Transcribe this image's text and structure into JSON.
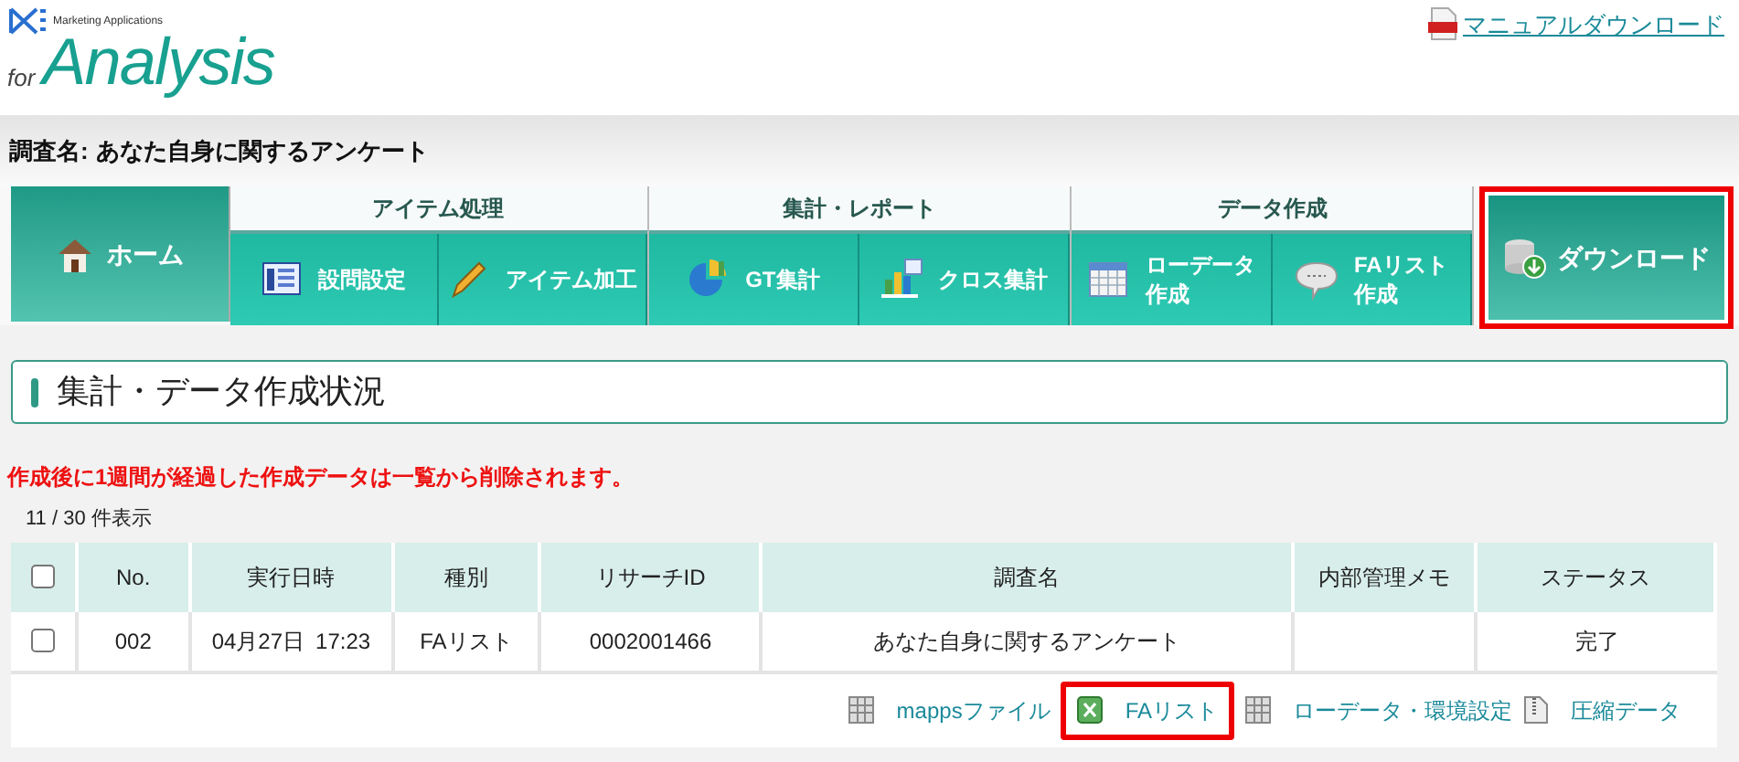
{
  "header": {
    "logo_tagline": "Marketing Applications",
    "logo_for": "for",
    "logo_name": "Analysis",
    "manual_link": "マニュアルダウンロード"
  },
  "survey_bar": {
    "label": "調査名:",
    "value": "あなた自身に関するアンケート"
  },
  "nav": {
    "home": {
      "label": "ホーム",
      "selected": true
    },
    "groups": [
      {
        "title": "アイテム処理",
        "items": [
          {
            "lines": [
              "設問設定"
            ],
            "kind": "form"
          },
          {
            "lines": [
              "アイテム加工"
            ],
            "kind": "pencil"
          }
        ]
      },
      {
        "title": "集計・レポート",
        "items": [
          {
            "lines": [
              "GT集計"
            ],
            "kind": "pie"
          },
          {
            "lines": [
              "クロス集計"
            ],
            "kind": "bar"
          }
        ]
      },
      {
        "title": "データ作成",
        "items": [
          {
            "lines": [
              "ローデータ",
              "作成"
            ],
            "kind": "grid"
          },
          {
            "lines": [
              "FAリスト",
              "作成"
            ],
            "kind": "bubble"
          }
        ]
      }
    ],
    "download": {
      "label": "ダウンロード",
      "highlighted": true
    }
  },
  "section_title": "集計・データ作成状況",
  "notice": "作成後に1週間が経過した作成データは一覧から削除されます。",
  "count": "11 / 30 件表示",
  "table": {
    "select_all_checked": false,
    "columns": [
      "No.",
      "実行日時",
      "種別",
      "リサーチID",
      "調査名",
      "内部管理メモ",
      "ステータス"
    ],
    "rows": [
      {
        "checked": false,
        "no": "002",
        "date": "04月27日",
        "time": "17:23",
        "type": "FAリスト",
        "research_id": "0002001466",
        "survey": "あなた自身に関するアンケート",
        "status": "完了",
        "actions": [
          {
            "label": "mappsファイル",
            "kind": "table",
            "highlighted": false
          },
          {
            "label": "FAリスト",
            "kind": "excel",
            "highlighted": true
          },
          {
            "label": "ローデータ・環境設定",
            "kind": "table",
            "highlighted": false
          },
          {
            "label": "圧縮データ",
            "kind": "zip",
            "highlighted": false
          }
        ]
      }
    ]
  }
}
